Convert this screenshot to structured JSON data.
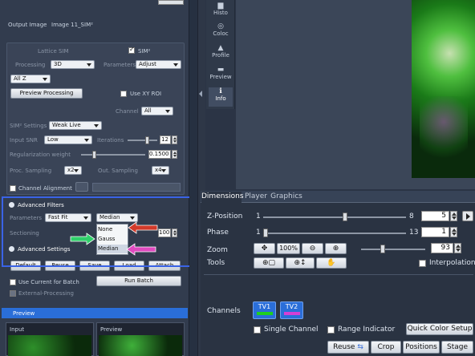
{
  "left_panel": {
    "output_image_label": "Output Image",
    "output_image_value": "Image 11_SIM²",
    "lattice_sim_label": "Lattice SIM",
    "sim2_checkbox_label": "SIM²",
    "processing_label": "Processing",
    "processing_value": "3D",
    "parameters_label": "Parameters",
    "parameters_value": "Adjust",
    "z_select_value": "All Z",
    "preview_processing_button": "Preview Processing",
    "use_xy_roi_label": "Use XY ROI",
    "channel_label": "Channel",
    "channel_value": "All",
    "sim2_settings_label": "SIM² Settings",
    "sim2_settings_value": "Weak Live",
    "input_snr_label": "Input SNR",
    "input_snr_value": "Low",
    "iterations_label": "Iterations",
    "iterations_value": "12",
    "regularization_label": "Regularization weight",
    "regularization_value": "0.1500",
    "proc_sampling_label": "Proc. Sampling",
    "proc_sampling_value": "x2",
    "out_sampling_label": "Out. Sampling",
    "out_sampling_value": "x4",
    "channel_alignment_label": "Channel Alignment",
    "advanced_filters_label": "Advanced Filters",
    "af_parameters_label": "Parameters",
    "af_parameters_value": "Fast Fit",
    "filter_value": "Median",
    "filter_options": [
      "None",
      "Gauss",
      "Median"
    ],
    "sectioning_label": "Sectioning",
    "sectioning_value": "100",
    "advanced_settings_label": "Advanced Settings",
    "bottom_buttons": [
      "Default",
      "Reuse",
      "Save",
      "Load",
      "Attach"
    ],
    "use_current_batch_label": "Use Current for Batch",
    "run_batch_button": "Run Batch",
    "external_processing_label": "External-Processing",
    "preview_section_label": "Preview",
    "input_tab": "Input",
    "preview_tab": "Preview"
  },
  "tool_strip": {
    "items": [
      "Histo",
      "Coloc",
      "Profile",
      "Preview",
      "Info"
    ]
  },
  "bottom_panel": {
    "tabs": [
      "Dimensions",
      "Player",
      "Graphics"
    ],
    "z_position_label": "Z-Position",
    "z_min": "1",
    "z_max": "8",
    "z_value": "5",
    "phase_label": "Phase",
    "phase_min": "1",
    "phase_max": "13",
    "phase_value": "1",
    "zoom_label": "Zoom",
    "zoom_percent": "100%",
    "zoom_value": "93",
    "tools_label": "Tools",
    "interpolation_label": "Interpolation",
    "channels_label": "Channels",
    "channel_buttons": [
      "TV1",
      "TV2"
    ],
    "single_channel_label": "Single Channel",
    "range_indicator_label": "Range Indicator",
    "quick_color_setup_button": "Quick Color Setup",
    "footer_buttons": [
      "Reuse",
      "Crop",
      "Positions",
      "Stage"
    ]
  },
  "colors": {
    "highlight_box": "#3a63e6",
    "arrow_red": "#d23a2a",
    "arrow_green": "#2fd06a",
    "arrow_pink": "#e04ac0",
    "panel_bg": "#2b3445",
    "preview_header": "#2a6ed8"
  }
}
